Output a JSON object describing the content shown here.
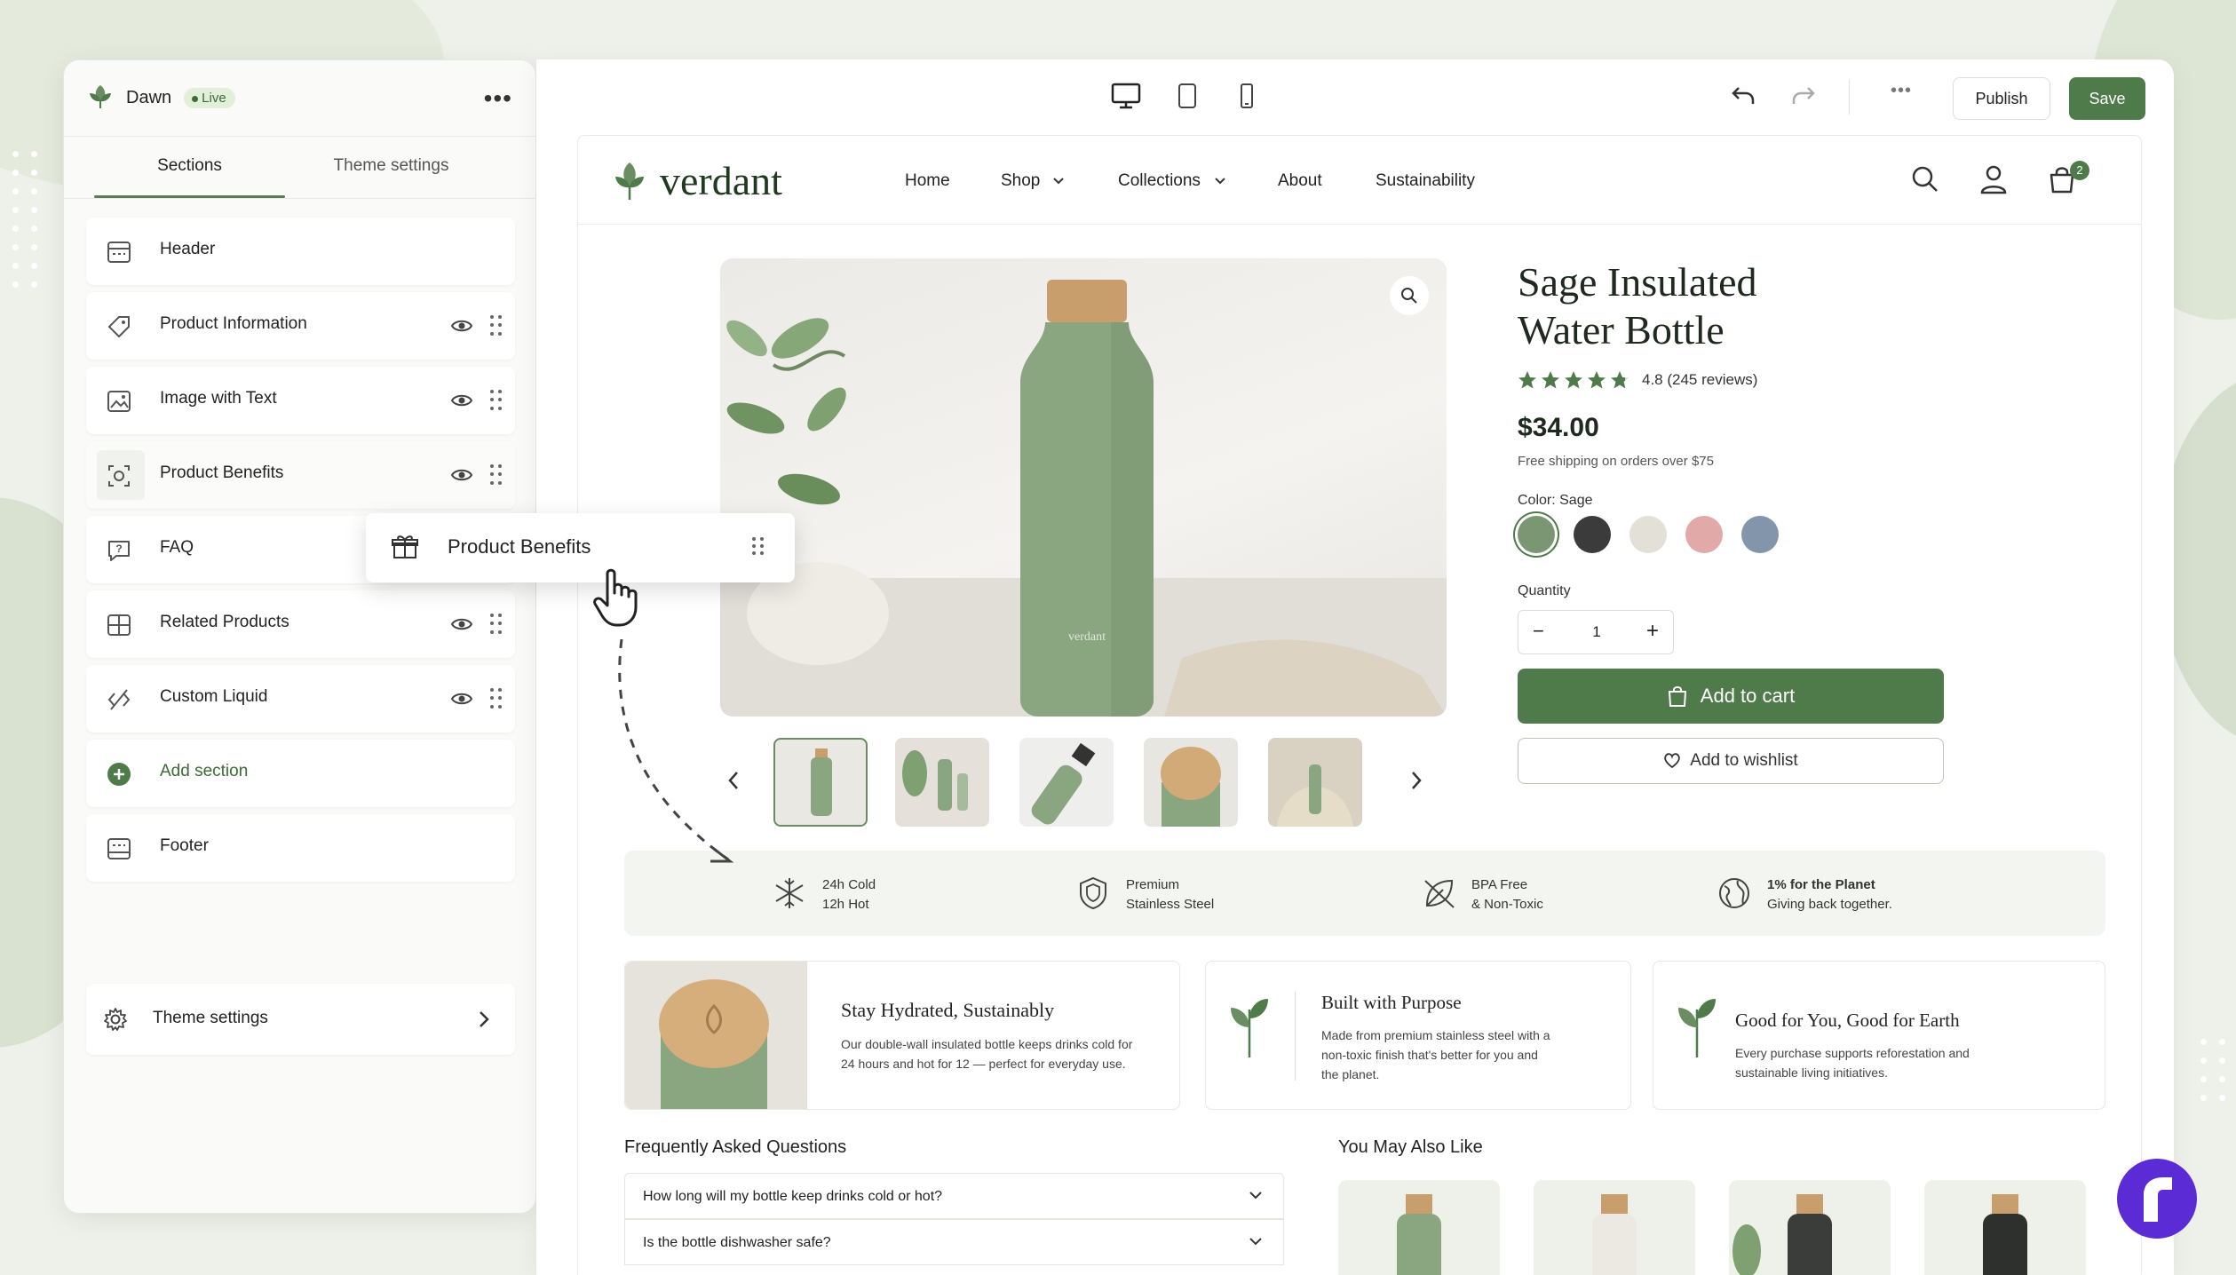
{
  "editor": {
    "theme_name": "Dawn",
    "status": "Live",
    "tabs": [
      "Sections",
      "Theme settings"
    ],
    "sections": [
      {
        "label": "Header",
        "icon": "header-layout-icon"
      },
      {
        "label": "Product Information",
        "icon": "tag-icon"
      },
      {
        "label": "Image with Text",
        "icon": "image-icon"
      },
      {
        "label": "Product Benefits",
        "icon": "benefits-icon"
      },
      {
        "label": "FAQ",
        "icon": "question-icon"
      },
      {
        "label": "Related Products",
        "icon": "grid-plus-icon"
      },
      {
        "label": "Custom Liquid",
        "icon": "code-icon"
      },
      {
        "label": "Add section",
        "icon": "plus-circle-icon"
      },
      {
        "label": "Footer",
        "icon": "footer-layout-icon"
      }
    ],
    "dragging": "Product Benefits",
    "theme_settings": "Theme settings",
    "publish": "Publish",
    "save": "Save"
  },
  "store": {
    "brand": "verdant",
    "nav": [
      "Home",
      "Shop",
      "Collections",
      "About",
      "Sustainability"
    ],
    "cart_count": "2",
    "product": {
      "title_line1": "Sage Insulated",
      "title_line2": "Water Bottle",
      "rating": 4.8,
      "rating_text": "4.8 (245 reviews)",
      "price": "$34.00",
      "shipping": "Free shipping on orders over $75",
      "color_label": "Color: Sage",
      "colors": [
        "#7b9673",
        "#3b3b3b",
        "#e3e0d8",
        "#e1a9a7",
        "#8295aa"
      ],
      "quantity_label": "Quantity",
      "quantity": "1",
      "add_to_cart": "Add to cart",
      "add_to_wishlist": "Add to wishlist",
      "bottle_logo": "verdant"
    },
    "features": [
      {
        "l1": "24h Cold",
        "l2": "12h Hot",
        "icon": "snowflake-icon"
      },
      {
        "l1": "Premium",
        "l2": "Stainless Steel",
        "icon": "shield-icon"
      },
      {
        "l1": "BPA Free",
        "l2": "& Non-Toxic",
        "icon": "leaf-icon"
      },
      {
        "l1": "1% for the Planet",
        "l2": "Giving back together.",
        "icon": "globe-icon"
      }
    ],
    "cards": [
      {
        "title": "Stay Hydrated, Sustainably",
        "body1": "Our double-wall insulated bottle keeps drinks cold for",
        "body2": "24 hours and hot for 12 — perfect for everyday use."
      },
      {
        "title": "Built with Purpose",
        "body1": "Made from premium stainless steel with a",
        "body2": "non-toxic finish that's better for you and",
        "body3": "the planet."
      },
      {
        "title": "Good for You, Good for Earth",
        "body1": "Every purchase supports reforestation and",
        "body2": "sustainable living initiatives."
      }
    ],
    "faq_title": "Frequently Asked Questions",
    "faqs": [
      "How long will my bottle keep drinks cold or hot?",
      "Is the bottle dishwasher safe?"
    ],
    "related_title": "You May Also Like"
  },
  "colors": {
    "accent": "#4f7a4a",
    "accent_dark": "#3d6b37"
  }
}
